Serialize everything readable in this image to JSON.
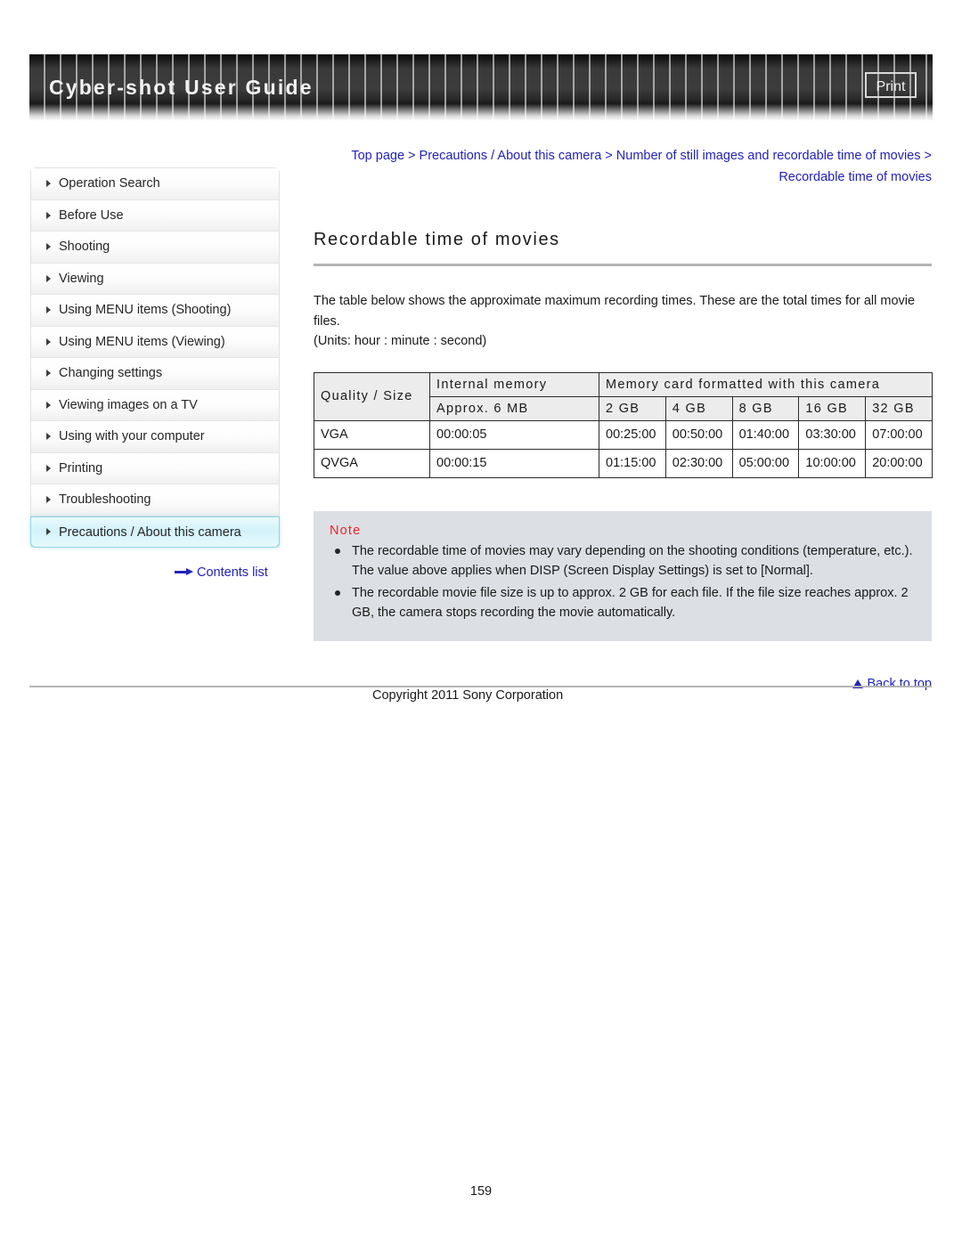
{
  "header": {
    "title": "Cyber-shot User Guide",
    "print_label": "Print"
  },
  "sidebar": {
    "items": [
      {
        "label": "Operation Search"
      },
      {
        "label": "Before Use"
      },
      {
        "label": "Shooting"
      },
      {
        "label": "Viewing"
      },
      {
        "label": "Using MENU items (Shooting)"
      },
      {
        "label": "Using MENU items (Viewing)"
      },
      {
        "label": "Changing settings"
      },
      {
        "label": "Viewing images on a TV"
      },
      {
        "label": "Using with your computer"
      },
      {
        "label": "Printing"
      },
      {
        "label": "Troubleshooting"
      },
      {
        "label": "Precautions / About this camera"
      }
    ],
    "selected_index": 11,
    "contents_link": "Contents list"
  },
  "main": {
    "breadcrumb": "Top page > Precautions / About this camera > Number of still images and recordable time of movies > Recordable time of movies",
    "title": "Recordable time of movies",
    "intro_line1": "The table below shows the approximate maximum recording times. These are the total times for all movie files.",
    "intro_line2": "(Units: hour : minute : second)"
  },
  "table": {
    "corner_header": "Quality / Size",
    "group_internal": "Internal memory",
    "group_card": "Memory card formatted with this camera",
    "sub_headers": [
      "Approx. 6 MB",
      "2 GB",
      "4 GB",
      "8 GB",
      "16 GB",
      "32 GB"
    ],
    "rows": [
      {
        "quality": "VGA",
        "values": [
          "00:00:05",
          "00:25:00",
          "00:50:00",
          "01:40:00",
          "03:30:00",
          "07:00:00"
        ]
      },
      {
        "quality": "QVGA",
        "values": [
          "00:00:15",
          "01:15:00",
          "02:30:00",
          "05:00:00",
          "10:00:00",
          "20:00:00"
        ]
      }
    ]
  },
  "note": {
    "label": "Note",
    "items": [
      "The recordable time of movies may vary depending on the shooting conditions (temperature, etc.). The value above applies when DISP (Screen Display Settings) is set to [Normal].",
      "The recordable movie file size is up to approx. 2 GB for each file. If the file size reaches approx. 2 GB, the camera stops recording the movie automatically."
    ]
  },
  "footer": {
    "back_to_top": "Back to top",
    "copyright": "Copyright 2011 Sony Corporation",
    "page_number": "159"
  },
  "colors": {
    "link": "#2222bb",
    "note_label": "#e8262a",
    "note_bg": "#dcdfe4",
    "selected_bg": "#d3f2fa",
    "table_header_bg": "#ececec"
  }
}
